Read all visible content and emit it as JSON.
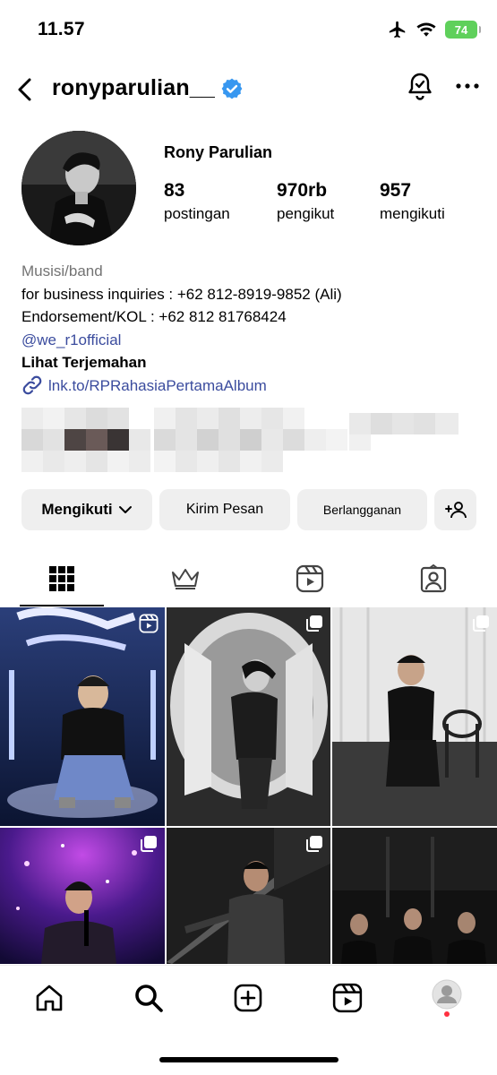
{
  "status_bar": {
    "time": "11.57",
    "battery": "74"
  },
  "header": {
    "username": "ronyparulian__"
  },
  "profile": {
    "full_name": "Rony Parulian",
    "stats": [
      {
        "value": "83",
        "label": "postingan"
      },
      {
        "value": "970rb",
        "label": "pengikut"
      },
      {
        "value": "957",
        "label": "mengikuti"
      }
    ],
    "bio": {
      "category": "Musisi/band",
      "line1": "for business inquiries : +62 812-8919-9852 (Ali)",
      "line2": "Endorsement/KOL :  +62 812 81768424",
      "mention": "@we_r1official",
      "translate": "Lihat Terjemahan",
      "link": "lnk.to/RPRahasiaPertamaAlbum"
    }
  },
  "actions": {
    "following": "Mengikuti",
    "message": "Kirim Pesan",
    "subscribe": "Berlangganan"
  },
  "tabs": [
    "grid-icon",
    "crown-icon",
    "reels-icon",
    "tagged-icon"
  ],
  "grid_posts": [
    {
      "type": "reel",
      "tone": "blue stage with graffiti"
    },
    {
      "type": "carousel",
      "tone": "black and white fisheye"
    },
    {
      "type": "carousel",
      "tone": "dark studio seated"
    },
    {
      "type": "carousel",
      "tone": "purple concert stage"
    },
    {
      "type": "carousel",
      "tone": "dark moody portrait"
    },
    {
      "type": "carousel",
      "tone": "group photo dark"
    }
  ],
  "bottom_nav": [
    "home-icon",
    "search-icon",
    "create-icon",
    "reels-icon",
    "profile-avatar"
  ],
  "colors": {
    "verified": "#3797f0",
    "link": "#3b4c9e",
    "button_bg": "#efefef",
    "battery": "#5fd05b"
  }
}
